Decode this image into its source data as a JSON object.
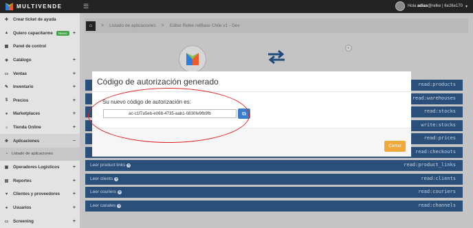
{
  "brand": {
    "name": "MULTIVENDE",
    "colors": {
      "primary": "#2a4f7b",
      "accent": "#f0a93b",
      "topbar": "#232323"
    }
  },
  "user": {
    "greeting": "Hola",
    "name": "adias",
    "extra": "@relke | 6e26e170",
    "caret": "▾"
  },
  "sidebar": {
    "items": [
      {
        "label": "Crear ticket de ayuda",
        "icon": "ticket-icon",
        "expand": ""
      },
      {
        "label": "Quiero capacitarme",
        "icon": "graduation-icon",
        "badge": "Nuevo",
        "expand": "+"
      },
      {
        "label": "Panel de control",
        "icon": "dashboard-icon",
        "expand": ""
      },
      {
        "label": "Catálogo",
        "icon": "tag-icon",
        "expand": "+"
      },
      {
        "label": "Ventas",
        "icon": "money-icon",
        "expand": "+"
      },
      {
        "label": "Inventario",
        "icon": "wrench-icon",
        "expand": "+"
      },
      {
        "label": "Precios",
        "icon": "dollar-icon",
        "expand": "+"
      },
      {
        "label": "Marketplaces",
        "icon": "globe-icon",
        "expand": "+"
      },
      {
        "label": "Tienda Online",
        "icon": "store-icon",
        "expand": "+"
      },
      {
        "label": "Aplicaciones",
        "icon": "puzzle-icon",
        "expand": "−"
      }
    ],
    "sub_item": "Listado de aplicaciones",
    "items_after": [
      {
        "label": "Operadores Logísticos",
        "icon": "truck-icon",
        "expand": "+"
      },
      {
        "label": "Reportes",
        "icon": "chart-icon",
        "expand": "+"
      },
      {
        "label": "Clientes y proveedores",
        "icon": "heart-icon",
        "expand": "+"
      },
      {
        "label": "Usuarios",
        "icon": "users-icon",
        "expand": "+"
      },
      {
        "label": "Screening",
        "icon": "screen-icon",
        "expand": "+"
      }
    ]
  },
  "breadcrumb": {
    "items": [
      "Listado de aplicaciones",
      "Editar Relke relBase Chile v1 - Dev"
    ],
    "separator": ">"
  },
  "permissions": [
    {
      "label": "",
      "code": "read:products"
    },
    {
      "label": "",
      "code": "read:warehouses"
    },
    {
      "label": "",
      "code": "read:stocks"
    },
    {
      "label": "",
      "code": "write:stocks"
    },
    {
      "label": "",
      "code": "read:prices"
    },
    {
      "label": "",
      "code": "read:checkouts"
    },
    {
      "label": "Leer product links",
      "code": "read:product_links"
    },
    {
      "label": "Leer clients",
      "code": "read:clients"
    },
    {
      "label": "Leer couriers",
      "code": "read:couriers"
    },
    {
      "label": "Leer canales",
      "code": "read:channels"
    }
  ],
  "modal": {
    "title": "Código de autorización generado",
    "label": "Su nuevo código de autorización es:",
    "code": "ac-c1f7a5eb-e068-4735-aab1-0830fe9fb9fb",
    "close_label": "Cerrar"
  }
}
